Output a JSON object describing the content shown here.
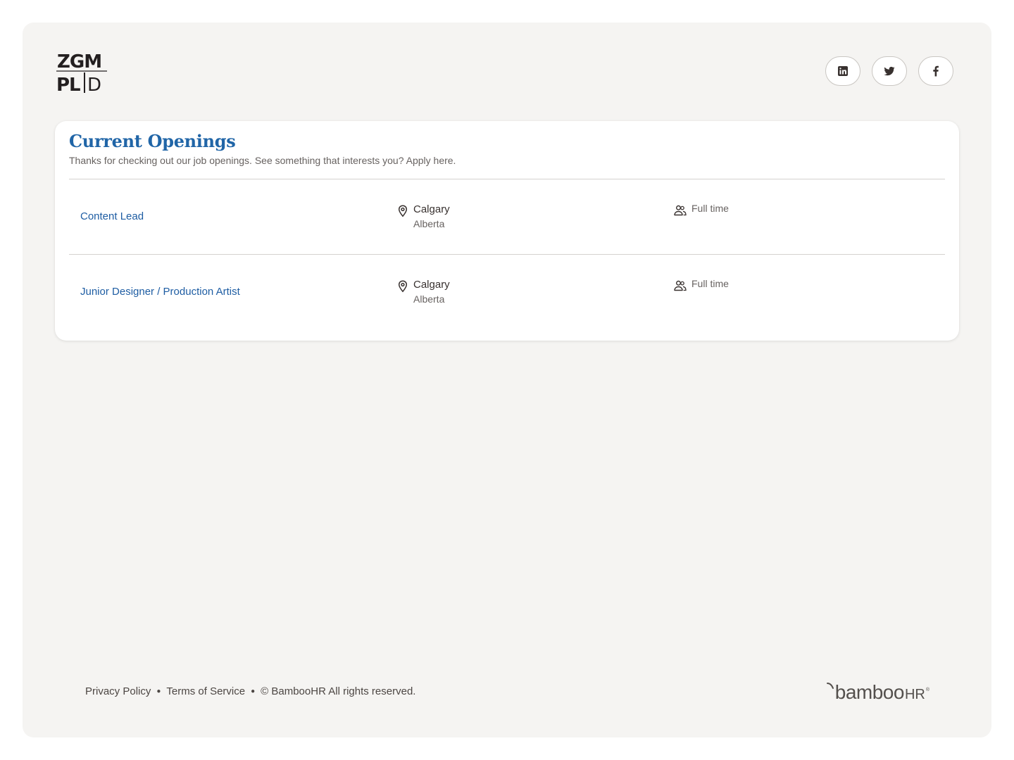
{
  "company_logo": {
    "icon": "zgm-pld-logo",
    "line1": "ZGM",
    "line2_left": "PL",
    "line2_right": "D"
  },
  "social": [
    {
      "name": "linkedin",
      "icon": "linkedin-icon"
    },
    {
      "name": "twitter",
      "icon": "twitter-icon"
    },
    {
      "name": "facebook",
      "icon": "facebook-icon"
    }
  ],
  "openings": {
    "title": "Current Openings",
    "subtitle": "Thanks for checking out our job openings. See something that interests you? Apply here.",
    "jobs": [
      {
        "title": "Content Lead",
        "city": "Calgary",
        "region": "Alberta",
        "type": "Full time"
      },
      {
        "title": "Junior Designer / Production Artist",
        "city": "Calgary",
        "region": "Alberta",
        "type": "Full time"
      }
    ]
  },
  "footer": {
    "privacy": "Privacy Policy",
    "terms": "Terms of Service",
    "copyright": "© BambooHR All rights reserved."
  },
  "brand": {
    "main": "bamboo",
    "hr": "HR",
    "reg": "®"
  },
  "colors": {
    "accent": "#2065a7",
    "link": "#1e5da3",
    "background": "#f5f4f2",
    "text": "#38312f",
    "muted": "#676260"
  }
}
